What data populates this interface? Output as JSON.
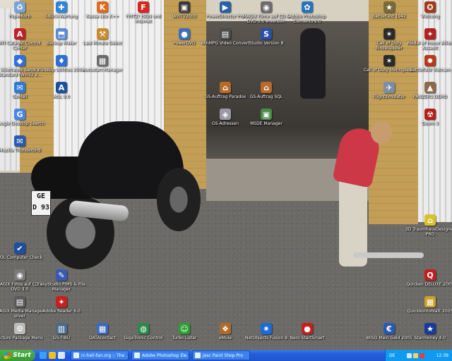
{
  "desktop_icons": [
    {
      "label": "PaperKorb",
      "icon": "recycle-bin-icon",
      "color": "#7aa4d8",
      "glyph": "♻"
    },
    {
      "label": "I-Klick-Wartung",
      "icon": "maintenance-icon",
      "color": "#2f86d6",
      "glyph": "✚"
    },
    {
      "label": "Kazaa Lite K++",
      "icon": "kazaa-icon",
      "color": "#e06a1b",
      "glyph": "K"
    },
    {
      "label": "FRITZ! ISDN und Internet",
      "icon": "fritz-icon",
      "color": "#d7271e",
      "glyph": "F"
    },
    {
      "label": "WinTV2000",
      "icon": "tv-icon",
      "color": "#3a3a3a",
      "glyph": "▣"
    },
    {
      "label": "PowerDirector Pro",
      "icon": "powerdirector-icon",
      "color": "#2b5fa8",
      "glyph": "▶"
    },
    {
      "label": "MAGIX Filme auf CD & DVD 3.0 e-version",
      "icon": "magix-disc-icon",
      "color": "#6c6c6c",
      "glyph": "◉"
    },
    {
      "label": "Adobe Photoshop Elements 2.0",
      "icon": "photoshop-icon",
      "color": "#2c73b9",
      "glyph": "✿"
    },
    {
      "label": "Battlefield 1942",
      "icon": "battlefield-icon",
      "color": "#7a6a3a",
      "glyph": "★"
    },
    {
      "label": "Vietcong",
      "icon": "vietcong-icon",
      "color": "#a23a1a",
      "glyph": "✪"
    },
    {
      "label": "ATI Catalyst Control Center",
      "icon": "ati-icon",
      "color": "#c21f2a",
      "glyph": "A"
    },
    {
      "label": "Backup Maker",
      "icon": "backup-icon",
      "color": "#5b8bd0",
      "glyph": "⬒"
    },
    {
      "label": "Last Minute Gebot",
      "icon": "hammer-icon",
      "color": "#c88a2a",
      "glyph": "⚒"
    },
    {
      "label": "PowerDVD",
      "icon": "dvd-icon",
      "color": "#3c6fc0",
      "glyph": "●"
    },
    {
      "label": "WinMPG Video Convert",
      "icon": "video-convert-icon",
      "color": "#4d4d4d",
      "glyph": "▤"
    },
    {
      "label": "Studio Version 8",
      "icon": "studio-icon",
      "color": "#2a4fa8",
      "glyph": "S"
    },
    {
      "label": "Call of Duty Einzelspieler",
      "icon": "cod-icon",
      "color": "#2a2a2a",
      "glyph": "✶"
    },
    {
      "label": "Medal of Honor Allied Assault",
      "icon": "moh-icon",
      "color": "#b32020",
      "glyph": "✦"
    },
    {
      "label": "SiSoftware Sandra Standard (Win32 x...",
      "icon": "sandra-icon",
      "color": "#2f6fe0",
      "glyph": "◆"
    },
    {
      "label": "TuneUp Utilities 2004",
      "icon": "tuneup-icon",
      "color": "#2f6fd0",
      "glyph": "♦"
    },
    {
      "label": "Autostart-Manager",
      "icon": "autostart-icon",
      "color": "#6b6b6b",
      "glyph": "▦"
    },
    {
      "label": "Call of Duty Mehrspieler",
      "icon": "cod-mp-icon",
      "color": "#2a2a2a",
      "glyph": "✶"
    },
    {
      "label": "Battlefield Vietnam",
      "icon": "bfv-icon",
      "color": "#b33a1a",
      "glyph": "✹"
    },
    {
      "label": "GeMail",
      "icon": "gemail-icon",
      "color": "#2e7bd6",
      "glyph": "✉"
    },
    {
      "label": "AOL 9.0",
      "icon": "aol-icon",
      "color": "#1d4fa0",
      "glyph": "A"
    },
    {
      "label": "GS-Auftrag Paradox",
      "icon": "gs-paradox-icon",
      "color": "#b76a2a",
      "glyph": "⌂"
    },
    {
      "label": "GS-Auftrag SQL",
      "icon": "gs-sql-icon",
      "color": "#b76a2a",
      "glyph": "⌂"
    },
    {
      "label": "Flightsimulator",
      "icon": "flightsim-icon",
      "color": "#7c8ea4",
      "glyph": "✈"
    },
    {
      "label": "PANZERS DEMO",
      "icon": "panzers-icon",
      "color": "#8a6a4a",
      "glyph": "▲"
    },
    {
      "label": "Google Desktop Search",
      "icon": "google-icon",
      "color": "#4a84e8",
      "glyph": "G"
    },
    {
      "label": "GS-Adressen",
      "icon": "gs-adressen-icon",
      "color": "#9a9aa6",
      "glyph": "◈"
    },
    {
      "label": "MSDE Manager",
      "icon": "msde-icon",
      "color": "#4a8a4a",
      "glyph": "▣"
    },
    {
      "label": "Doom 3",
      "icon": "doom-icon",
      "color": "#b3201a",
      "glyph": "☢"
    },
    {
      "label": "Mozilla Thunderbird",
      "icon": "thunderbird-icon",
      "color": "#2a5ab0",
      "glyph": "✉"
    },
    {
      "label": "3D TraumhausDesigner PRO",
      "icon": "traumhaus-icon",
      "color": "#d8c22a",
      "glyph": "⌂"
    },
    {
      "label": "AOL Computer Check",
      "icon": "aol-check-icon",
      "color": "#1d4fa0",
      "glyph": "✔"
    },
    {
      "label": "MAGIX Fotos auf CD & DVD 3.0",
      "icon": "magix-fotos-icon",
      "color": "#7a7a7a",
      "glyph": "◉"
    },
    {
      "label": "EasyStudio PIMS & File Manager",
      "icon": "easystudio-icon",
      "color": "#3a5ab0",
      "glyph": "✎"
    },
    {
      "label": "Quicken DELUXE 2005",
      "icon": "quicken-icon",
      "color": "#c41e22",
      "glyph": "Q"
    },
    {
      "label": "MAGIX Media Manager silver",
      "icon": "magix-media-icon",
      "color": "#5a5a5a",
      "glyph": "▤"
    },
    {
      "label": "Adobe Reader 6.0",
      "icon": "adobe-reader-icon",
      "color": "#c8201e",
      "glyph": "✦"
    },
    {
      "label": "Quickkontoblatt 2005",
      "icon": "quickkonto-icon",
      "color": "#c8a02a",
      "glyph": "▦"
    },
    {
      "label": "Picture Package Menu",
      "icon": "picture-package-icon",
      "color": "#bcbcbc",
      "glyph": "⚙"
    },
    {
      "label": "GS-FIBU",
      "icon": "gs-fibu-icon",
      "color": "#4a6a8a",
      "glyph": "▥"
    },
    {
      "label": "DATAcontact",
      "icon": "datacontact-icon",
      "color": "#3a6ac0",
      "glyph": "▦"
    },
    {
      "label": "GigaTronic Control",
      "icon": "gigatronic-icon",
      "color": "#2a8a4a",
      "glyph": "◍"
    },
    {
      "label": "Turbo Lister",
      "icon": "turbo-lister-icon",
      "color": "#2aa030",
      "glyph": "☺"
    },
    {
      "label": "eMule",
      "icon": "emule-icon",
      "color": "#b06a2a",
      "glyph": "❖"
    },
    {
      "label": "NetObjects Fusion 8",
      "icon": "netobjects-icon",
      "color": "#1a6ad8",
      "glyph": "✷"
    },
    {
      "label": "Nero StartSmart",
      "icon": "nero-icon",
      "color": "#c81e1e",
      "glyph": "●"
    },
    {
      "label": "WISO Mein Geld 2005",
      "icon": "wiso-icon",
      "color": "#2a5ab0",
      "glyph": "€"
    },
    {
      "label": "Starmoney  4.0",
      "icon": "starmoney-icon",
      "color": "#1a3a9a",
      "glyph": "★"
    }
  ],
  "wallpaper": {
    "license_plate_line1": "GE",
    "license_plate_line2": "D 93"
  },
  "taskbar": {
    "start_label": "Start",
    "quick_launch": [
      {
        "icon": "ie-icon",
        "color": "#3aa0f0"
      },
      {
        "icon": "outlook-icon",
        "color": "#f0c020"
      },
      {
        "icon": "show-desktop-icon",
        "color": "#d8e8ff"
      }
    ],
    "tasks": [
      {
        "label": "rc-heli-fan.org :: The ...",
        "icon": "browser-icon"
      },
      {
        "label": "Adobe Photoshop Ele...",
        "icon": "photoshop-task-icon"
      },
      {
        "label": "Jasc Paint Shop Pro",
        "icon": "paintshop-icon"
      }
    ],
    "tray_lang": "DE",
    "clock": "12:39"
  }
}
